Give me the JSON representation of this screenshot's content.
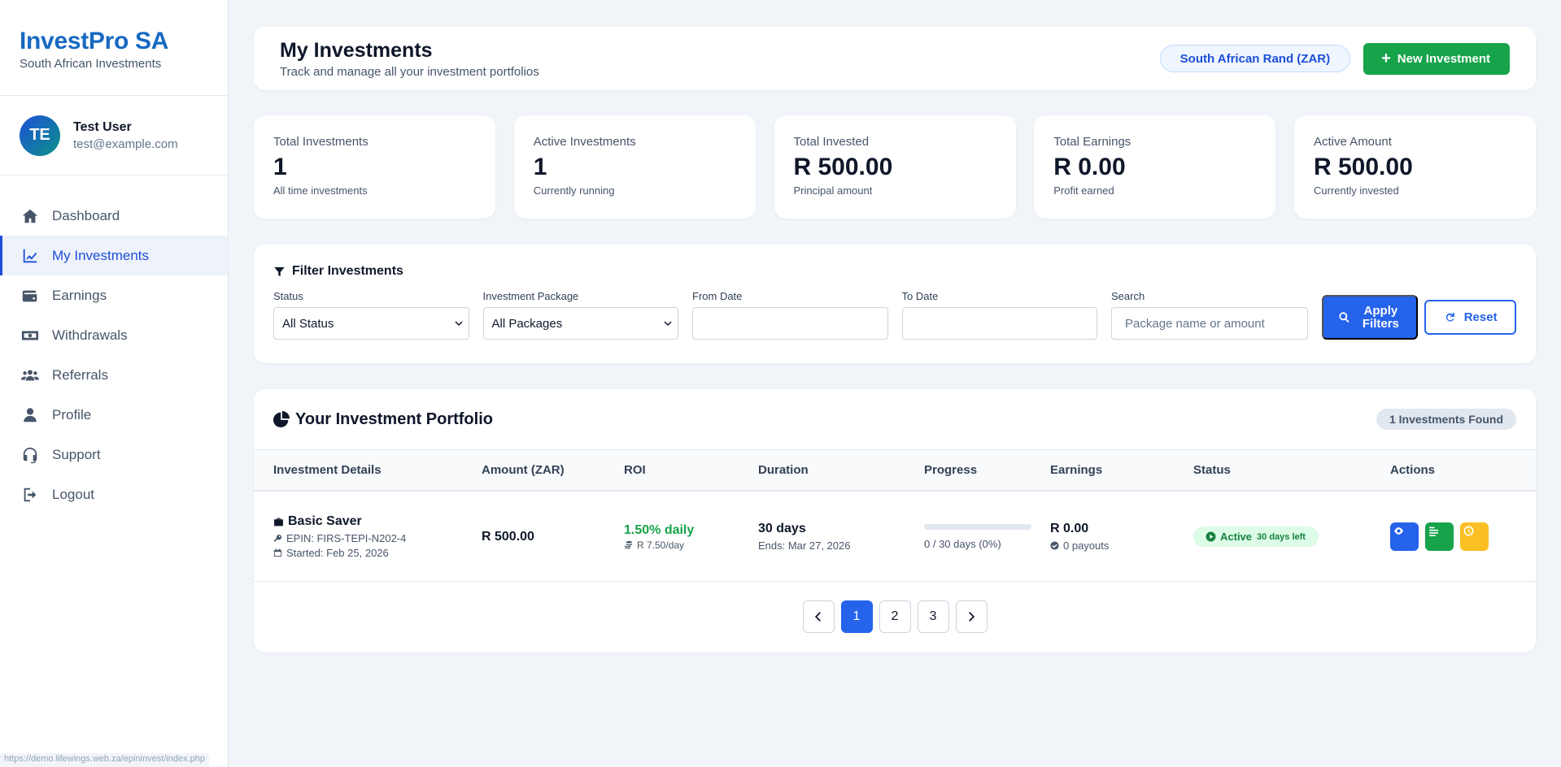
{
  "brand": {
    "title": "InvestPro SA",
    "subtitle": "South African Investments"
  },
  "user": {
    "initials": "TE",
    "name": "Test User",
    "email": "test@example.com"
  },
  "nav": [
    {
      "label": "Dashboard",
      "icon": "home-icon"
    },
    {
      "label": "My Investments",
      "icon": "chart-line-icon",
      "active": true
    },
    {
      "label": "Earnings",
      "icon": "wallet-icon"
    },
    {
      "label": "Withdrawals",
      "icon": "money-bill-icon"
    },
    {
      "label": "Referrals",
      "icon": "users-icon"
    },
    {
      "label": "Profile",
      "icon": "user-icon"
    },
    {
      "label": "Support",
      "icon": "headset-icon"
    },
    {
      "label": "Logout",
      "icon": "logout-icon"
    }
  ],
  "status_url": "https://demo.lifewings.web.za/epininvest/index.php",
  "header": {
    "title": "My Investments",
    "subtitle": "Track and manage all your investment portfolios",
    "currency": "South African Rand (ZAR)",
    "new_button": "New Investment"
  },
  "stats": [
    {
      "label": "Total Investments",
      "value": "1",
      "note": "All time investments"
    },
    {
      "label": "Active Investments",
      "value": "1",
      "note": "Currently running"
    },
    {
      "label": "Total Invested",
      "value": "R 500.00",
      "note": "Principal amount"
    },
    {
      "label": "Total Earnings",
      "value": "R 0.00",
      "note": "Profit earned"
    },
    {
      "label": "Active Amount",
      "value": "R 500.00",
      "note": "Currently invested"
    }
  ],
  "filter": {
    "title": "Filter Investments",
    "status_label": "Status",
    "status_value": "All Status",
    "package_label": "Investment Package",
    "package_value": "All Packages",
    "from_label": "From Date",
    "to_label": "To Date",
    "search_label": "Search",
    "search_placeholder": "Package name or amount",
    "apply_label": "Apply Filters",
    "reset_label": "Reset"
  },
  "portfolio": {
    "title": "Your Investment Portfolio",
    "found": "1 Investments Found",
    "columns": [
      "Investment Details",
      "Amount (ZAR)",
      "ROI",
      "Duration",
      "Progress",
      "Earnings",
      "Status",
      "Actions"
    ],
    "rows": [
      {
        "name": "Basic Saver",
        "epin": "EPIN: FIRS-TEPI-N202-4",
        "started": "Started: Feb 25, 2026",
        "amount": "R 500.00",
        "roi": "1.50% daily",
        "roi_sub": "R 7.50/day",
        "duration": "30 days",
        "ends": "Ends: Mar 27, 2026",
        "progress": 0,
        "progress_text": "0 / 30 days (0%)",
        "earnings": "R 0.00",
        "payouts": "0 payouts",
        "status": "Active",
        "days_left": "30 days left"
      }
    ]
  },
  "pagination": {
    "pages": [
      "1",
      "2",
      "3"
    ],
    "current": "1"
  },
  "colors": {
    "primary": "#2563eb",
    "success": "#16a34a",
    "warning": "#fbbf24",
    "brand": "#1769c2"
  }
}
